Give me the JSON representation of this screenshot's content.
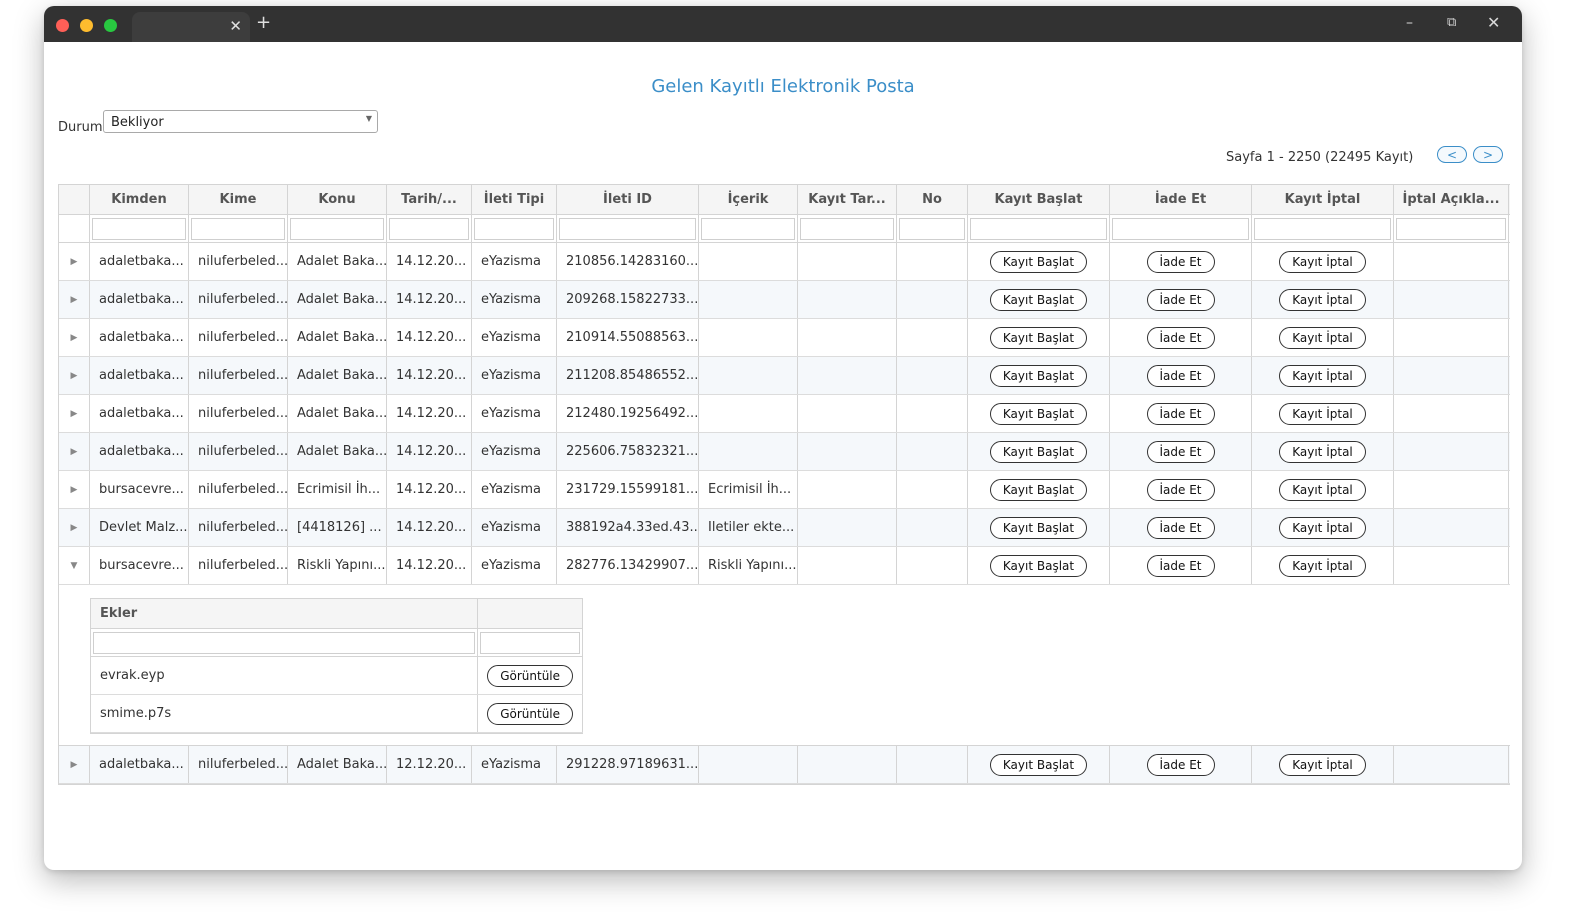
{
  "page": {
    "title": "Gelen Kayıtlı Elektronik Posta",
    "filter_label": "Durum",
    "filter_value": "Bekliyor",
    "pager_text": "Sayfa 1 - 2250 (22495 Kayıt)",
    "pager_prev": "<",
    "pager_next": ">"
  },
  "browser": {
    "tab_close": "✕",
    "tab_add": "+",
    "minimize": "–",
    "maximize": "⧉",
    "close": "✕"
  },
  "columns": [
    "Kimden",
    "Kime",
    "Konu",
    "Tarih/...",
    "İleti Tipi",
    "İleti ID",
    "İçerik",
    "Kayıt Tar...",
    "No",
    "Kayıt Başlat",
    "İade Et",
    "Kayıt İptal",
    "İptal Açıkla..."
  ],
  "buttons": {
    "start": "Kayıt Başlat",
    "return": "İade Et",
    "cancel": "Kayıt İptal",
    "view": "Görüntüle"
  },
  "icons": {
    "expand": "expand-arrow-icon",
    "collapse": "collapse-arrow-icon",
    "select_arrow": "dropdown-arrow-icon"
  },
  "rows": [
    {
      "kimden": "adaletbaka...",
      "kime": "niluferbeled...",
      "konu": "Adalet Baka...",
      "tarih": "14.12.20...",
      "tip": "eYazisma",
      "id": "210856.14283160...",
      "icerik": "",
      "kayit_tar": "",
      "no": "",
      "iptal_aciklama": "",
      "expanded": false
    },
    {
      "kimden": "adaletbaka...",
      "kime": "niluferbeled...",
      "konu": "Adalet Baka...",
      "tarih": "14.12.20...",
      "tip": "eYazisma",
      "id": "209268.15822733...",
      "icerik": "",
      "kayit_tar": "",
      "no": "",
      "iptal_aciklama": "",
      "expanded": false
    },
    {
      "kimden": "adaletbaka...",
      "kime": "niluferbeled...",
      "konu": "Adalet Baka...",
      "tarih": "14.12.20...",
      "tip": "eYazisma",
      "id": "210914.55088563...",
      "icerik": "",
      "kayit_tar": "",
      "no": "",
      "iptal_aciklama": "",
      "expanded": false
    },
    {
      "kimden": "adaletbaka...",
      "kime": "niluferbeled...",
      "konu": "Adalet Baka...",
      "tarih": "14.12.20...",
      "tip": "eYazisma",
      "id": "211208.85486552...",
      "icerik": "",
      "kayit_tar": "",
      "no": "",
      "iptal_aciklama": "",
      "expanded": false
    },
    {
      "kimden": "adaletbaka...",
      "kime": "niluferbeled...",
      "konu": "Adalet Baka...",
      "tarih": "14.12.20...",
      "tip": "eYazisma",
      "id": "212480.19256492...",
      "icerik": "",
      "kayit_tar": "",
      "no": "",
      "iptal_aciklama": "",
      "expanded": false
    },
    {
      "kimden": "adaletbaka...",
      "kime": "niluferbeled...",
      "konu": "Adalet Baka...",
      "tarih": "14.12.20...",
      "tip": "eYazisma",
      "id": "225606.75832321...",
      "icerik": "",
      "kayit_tar": "",
      "no": "",
      "iptal_aciklama": "",
      "expanded": false
    },
    {
      "kimden": "bursacevre...",
      "kime": "niluferbeled...",
      "konu": "Ecrimisil İh...",
      "tarih": "14.12.20...",
      "tip": "eYazisma",
      "id": "231729.15599181...",
      "icerik": "Ecrimisil İh...",
      "kayit_tar": "",
      "no": "",
      "iptal_aciklama": "",
      "expanded": false
    },
    {
      "kimden": "Devlet Malz...",
      "kime": "niluferbeled...",
      "konu": "[4418126] ...",
      "tarih": "14.12.20...",
      "tip": "eYazisma",
      "id": "388192a4.33ed.43...",
      "icerik": "Iletiler ekte...",
      "kayit_tar": "",
      "no": "",
      "iptal_aciklama": "",
      "expanded": false
    },
    {
      "kimden": "bursacevre...",
      "kime": "niluferbeled...",
      "konu": "Riskli Yapını...",
      "tarih": "14.12.20...",
      "tip": "eYazisma",
      "id": "282776.13429907...",
      "icerik": "Riskli Yapını...",
      "kayit_tar": "",
      "no": "",
      "iptal_aciklama": "",
      "expanded": true
    },
    {
      "kimden": "adaletbaka...",
      "kime": "niluferbeled...",
      "konu": "Adalet Baka...",
      "tarih": "12.12.20...",
      "tip": "eYazisma",
      "id": "291228.97189631...",
      "icerik": "",
      "kayit_tar": "",
      "no": "",
      "iptal_aciklama": "",
      "expanded": false
    }
  ],
  "attachments": {
    "columns": [
      "Ekler",
      ""
    ],
    "items": [
      {
        "name": "evrak.eyp"
      },
      {
        "name": "smime.p7s"
      }
    ]
  }
}
